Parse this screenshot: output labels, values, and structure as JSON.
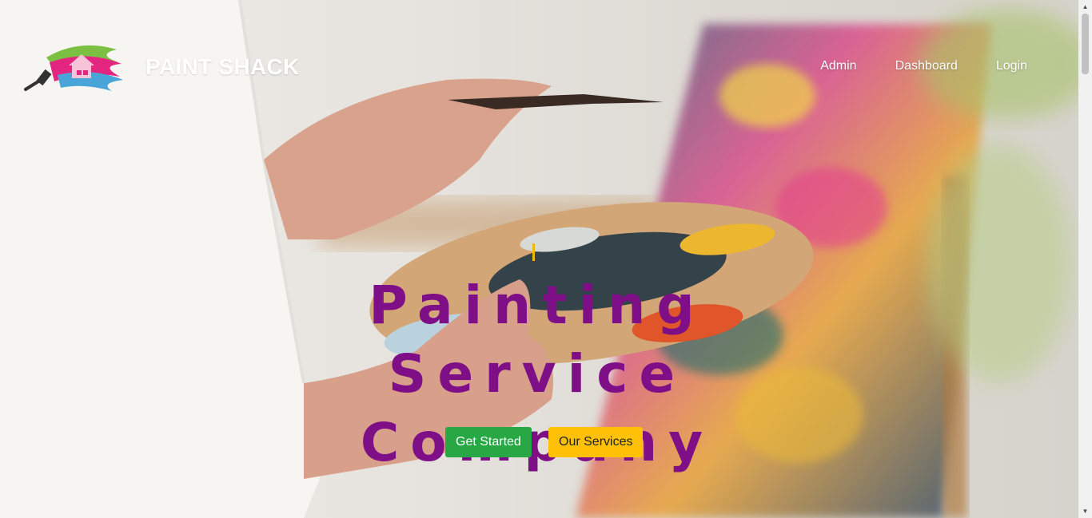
{
  "brand": {
    "name": "PAINT SHACK",
    "logo_icon": "paint-roller-house-icon"
  },
  "nav": {
    "items": [
      "Admin",
      "Dashboard",
      "Login"
    ]
  },
  "hero": {
    "headline": "Painting Service Company",
    "primary_button": "Get Started",
    "secondary_button": "Our Services"
  },
  "colors": {
    "headline": "#7e0f86",
    "primary_button": "#28a745",
    "secondary_button": "#ffc107",
    "cursor": "#f0b800"
  }
}
